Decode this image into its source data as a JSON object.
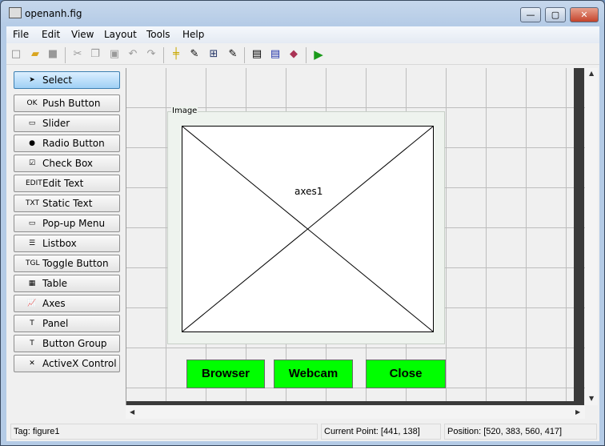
{
  "window": {
    "title": "openanh.fig",
    "minimize": "—",
    "maximize": "▢",
    "close": "✕"
  },
  "menu": [
    "File",
    "Edit",
    "View",
    "Layout",
    "Tools",
    "Help"
  ],
  "palette": [
    {
      "label": "Select",
      "icon": "➤"
    },
    {
      "label": "Push Button",
      "icon": "OK"
    },
    {
      "label": "Slider",
      "icon": "▭"
    },
    {
      "label": "Radio Button",
      "icon": "●"
    },
    {
      "label": "Check Box",
      "icon": "☑"
    },
    {
      "label": "Edit Text",
      "icon": "EDIT"
    },
    {
      "label": "Static Text",
      "icon": "TXT"
    },
    {
      "label": "Pop-up Menu",
      "icon": "▭"
    },
    {
      "label": "Listbox",
      "icon": "☰"
    },
    {
      "label": "Toggle Button",
      "icon": "TGL"
    },
    {
      "label": "Table",
      "icon": "▦"
    },
    {
      "label": "Axes",
      "icon": "📈"
    },
    {
      "label": "Panel",
      "icon": "T"
    },
    {
      "label": "Button Group",
      "icon": "T"
    },
    {
      "label": "ActiveX Control",
      "icon": "✕"
    }
  ],
  "canvas": {
    "panel_title": "Image",
    "axes_label": "axes1",
    "buttons": [
      "Browser",
      "Webcam",
      "Close"
    ],
    "button_color": "#00ff00"
  },
  "status": {
    "tag": "Tag: figure1",
    "current_point": "Current Point:  [441, 138]",
    "position": "Position: [520, 383, 560, 417]"
  }
}
